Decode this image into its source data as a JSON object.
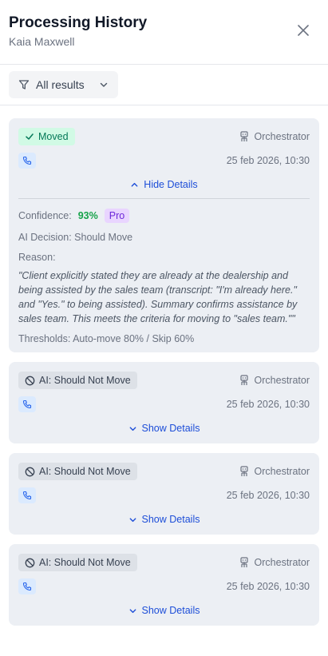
{
  "header": {
    "title": "Processing History",
    "subtitle": "Kaia Maxwell"
  },
  "filter": {
    "label": "All results"
  },
  "records": [
    {
      "status": "Moved",
      "status_kind": "moved",
      "source": "Orchestrator",
      "timestamp": "25 feb 2026, 10:30",
      "toggle_label": "Hide Details",
      "expanded": true,
      "details": {
        "confidence_label": "Confidence:",
        "confidence_value": "93%",
        "tier": "Pro",
        "decision": "AI Decision: Should Move",
        "reason_label": "Reason:",
        "reason": "\"Client explicitly stated they are already at the dealership and being assisted by the sales team (transcript: \"I'm already here.\" and \"Yes.\" to being assisted). Summary confirms assistance by sales team. This meets the criteria for moving to \"sales team.\"\"",
        "thresholds": "Thresholds: Auto-move 80% / Skip 60%"
      }
    },
    {
      "status": "AI: Should Not Move",
      "status_kind": "not-move",
      "source": "Orchestrator",
      "timestamp": "25 feb 2026, 10:30",
      "toggle_label": "Show Details",
      "expanded": false
    },
    {
      "status": "AI: Should Not Move",
      "status_kind": "not-move",
      "source": "Orchestrator",
      "timestamp": "25 feb 2026, 10:30",
      "toggle_label": "Show Details",
      "expanded": false
    },
    {
      "status": "AI: Should Not Move",
      "status_kind": "not-move",
      "source": "Orchestrator",
      "timestamp": "25 feb 2026, 10:30",
      "toggle_label": "Show Details",
      "expanded": false
    }
  ],
  "colors": {
    "accent": "#1d4ed8",
    "moved_bg": "#d1fae5",
    "moved_fg": "#047857",
    "confidence": "#16a34a",
    "pro_bg": "#e9d5ff",
    "card_bg": "#eceff4"
  },
  "icons": {
    "close": "close-icon",
    "filter": "filter-icon",
    "chevron": "chevron-down-icon",
    "check": "check-icon",
    "ban": "ban-icon",
    "robot": "robot-icon",
    "phone": "phone-icon"
  }
}
